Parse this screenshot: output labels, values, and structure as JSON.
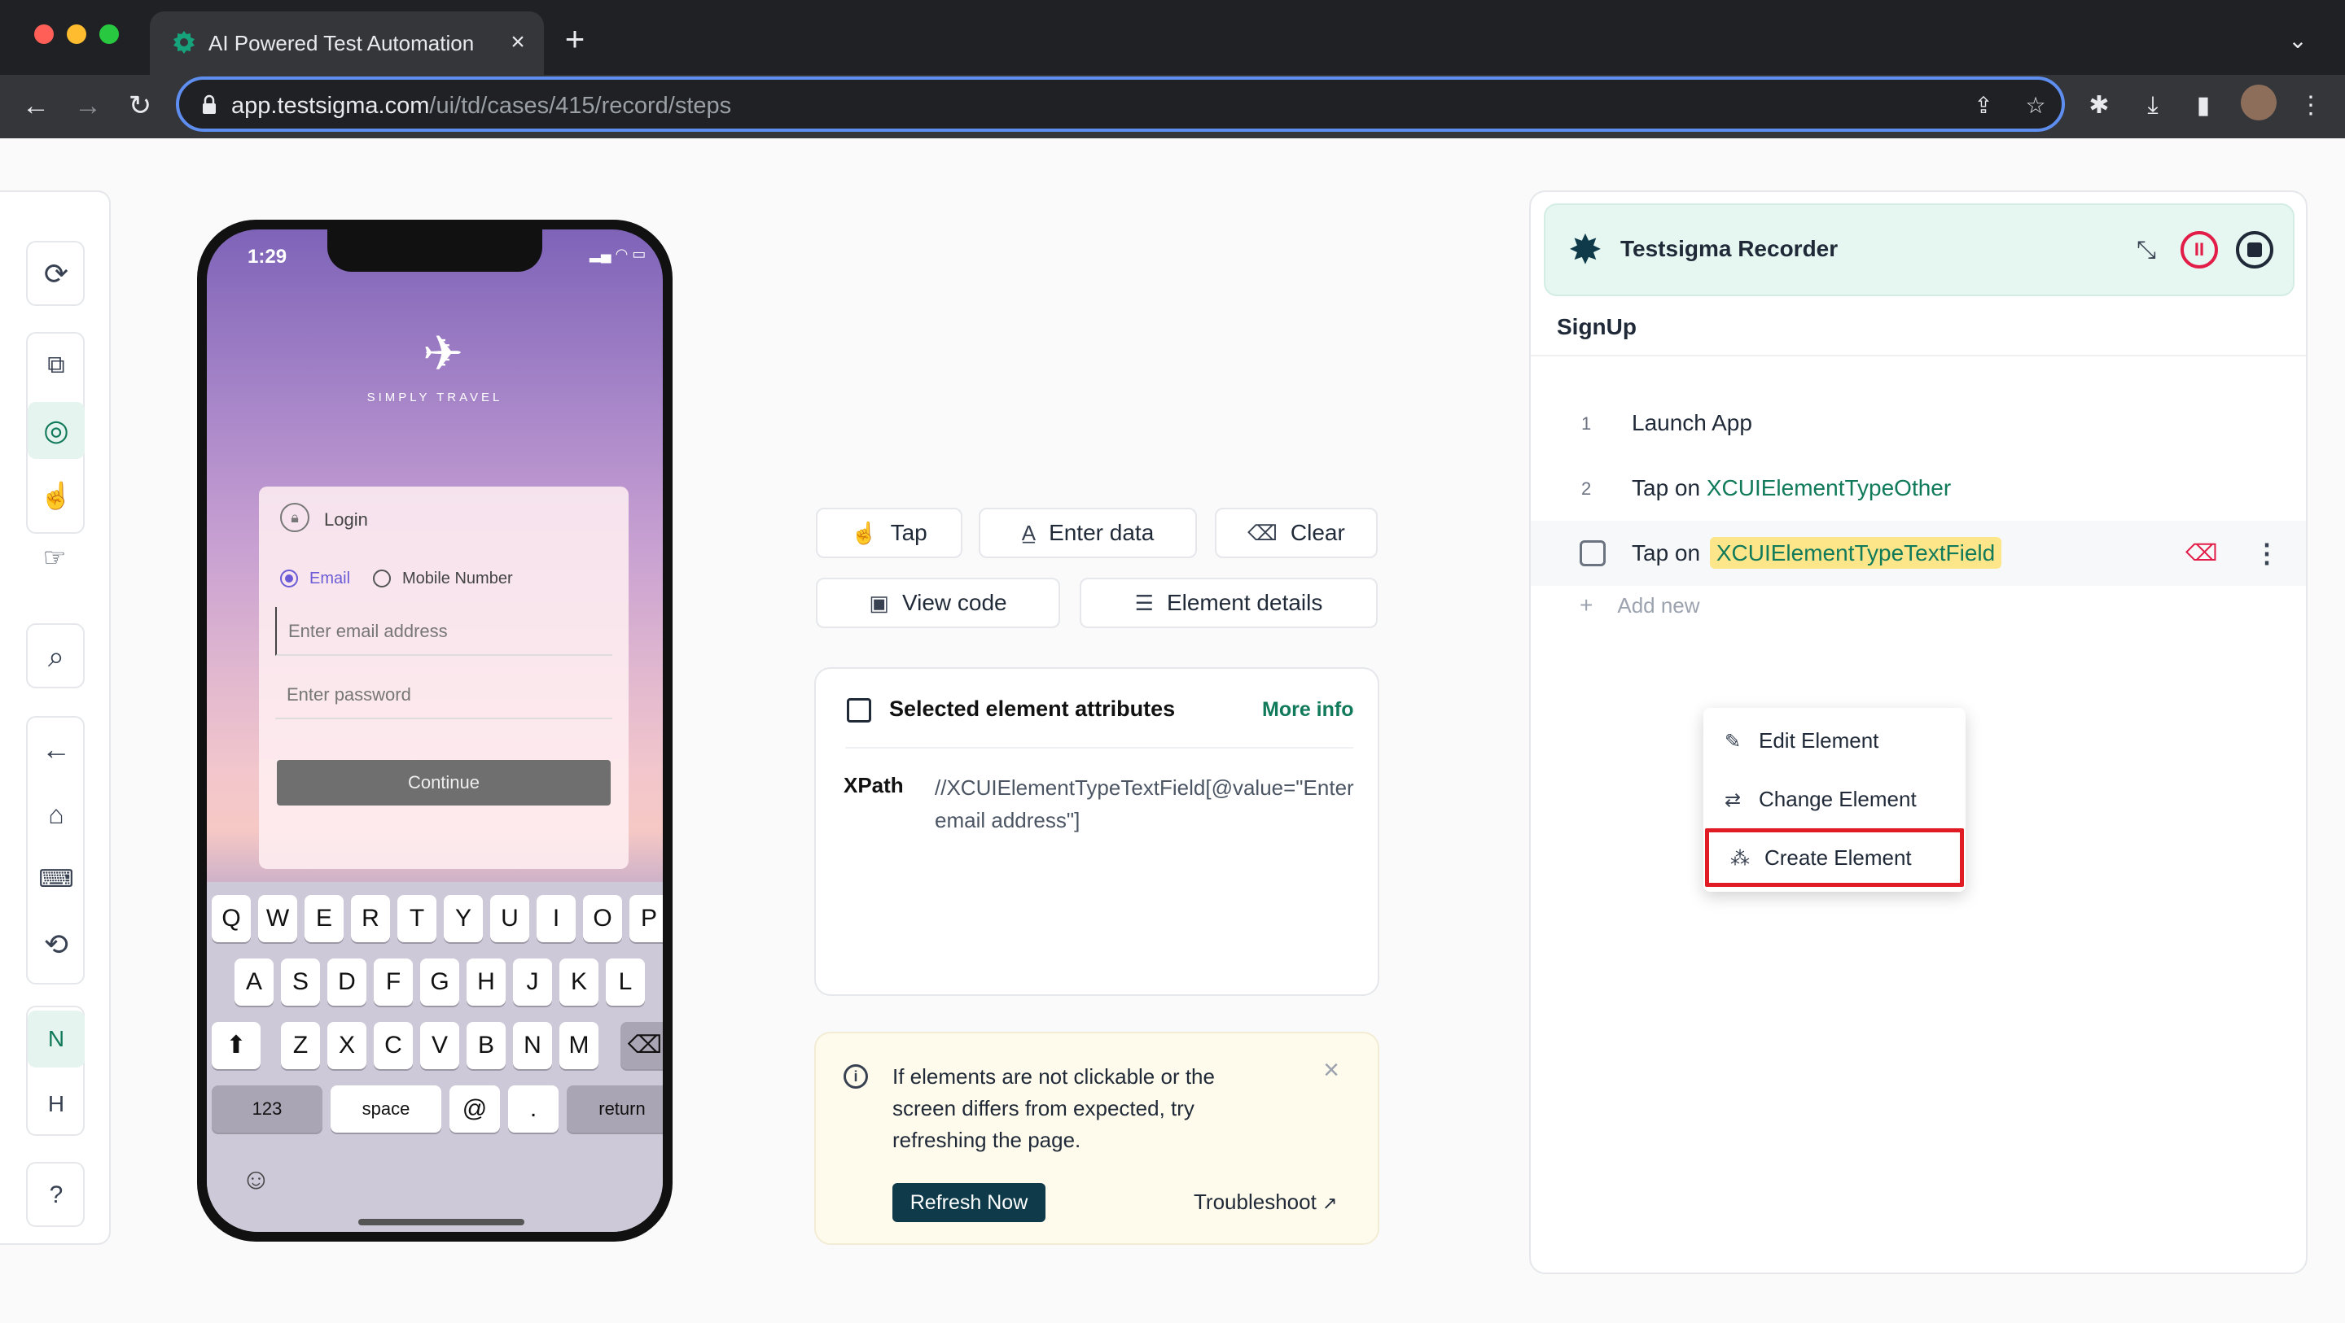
{
  "browser": {
    "tab_title": "AI Powered Test Automation P",
    "tab_close": "×",
    "new_tab": "+",
    "url_host": "app.testsigma.com",
    "url_path": "/ui/td/cases/415/record/steps",
    "traffic": {
      "red": "#ff5f57",
      "yellow": "#febc2e",
      "green": "#28c840"
    }
  },
  "sidebar": {
    "tools": [
      "refresh-icon",
      "device-icon",
      "inspect-icon",
      "gesture-icon",
      "tap-icon"
    ],
    "search": "search-icon",
    "nav": [
      "back-icon",
      "home-icon",
      "keyboard-icon",
      "rotate-icon"
    ],
    "letters": [
      "N",
      "H"
    ],
    "help": "?"
  },
  "phone": {
    "time": "1:29",
    "brand": "SIMPLY TRAVEL",
    "login_title": "Login",
    "radio_email": "Email",
    "radio_mobile": "Mobile Number",
    "email_placeholder": "Enter email address",
    "password_placeholder": "Enter password",
    "continue_label": "Continue",
    "keys_row1": [
      "Q",
      "W",
      "E",
      "R",
      "T",
      "Y",
      "U",
      "I",
      "O",
      "P"
    ],
    "keys_row2": [
      "A",
      "S",
      "D",
      "F",
      "G",
      "H",
      "J",
      "K",
      "L"
    ],
    "keys_row3": [
      "Z",
      "X",
      "C",
      "V",
      "B",
      "N",
      "M"
    ],
    "key_123": "123",
    "key_space": "space",
    "key_at": "@",
    "key_dot": ".",
    "key_return": "return"
  },
  "actions": {
    "tap": "Tap",
    "enter_data": "Enter data",
    "clear": "Clear",
    "view_code": "View code",
    "element_details": "Element details"
  },
  "attributes": {
    "title": "Selected element attributes",
    "more_info": "More info",
    "xpath_key": "XPath",
    "xpath_value": "//XCUIElementTypeTextField[@value=\"Enter email address\"]"
  },
  "info_box": {
    "message": "If elements are not clickable or the screen differs from expected, try refreshing the page.",
    "refresh": "Refresh Now",
    "troubleshoot": "Troubleshoot"
  },
  "recorder": {
    "title": "Testsigma Recorder",
    "case_name": "SignUp",
    "steps": [
      {
        "num": "1",
        "text": "Launch App",
        "element": ""
      },
      {
        "num": "2",
        "text": "Tap on",
        "element": "XCUIElementTypeOther"
      },
      {
        "num": "",
        "text": "Tap on",
        "element": "XCUIElementTypeTextField"
      }
    ],
    "add_new": "Add new"
  },
  "context_menu": {
    "items": [
      "Edit Element",
      "Change Element",
      "Create Element"
    ]
  },
  "colors": {
    "accent": "#117a5a",
    "highlight": "#fde68a",
    "box": "#e01b24"
  }
}
